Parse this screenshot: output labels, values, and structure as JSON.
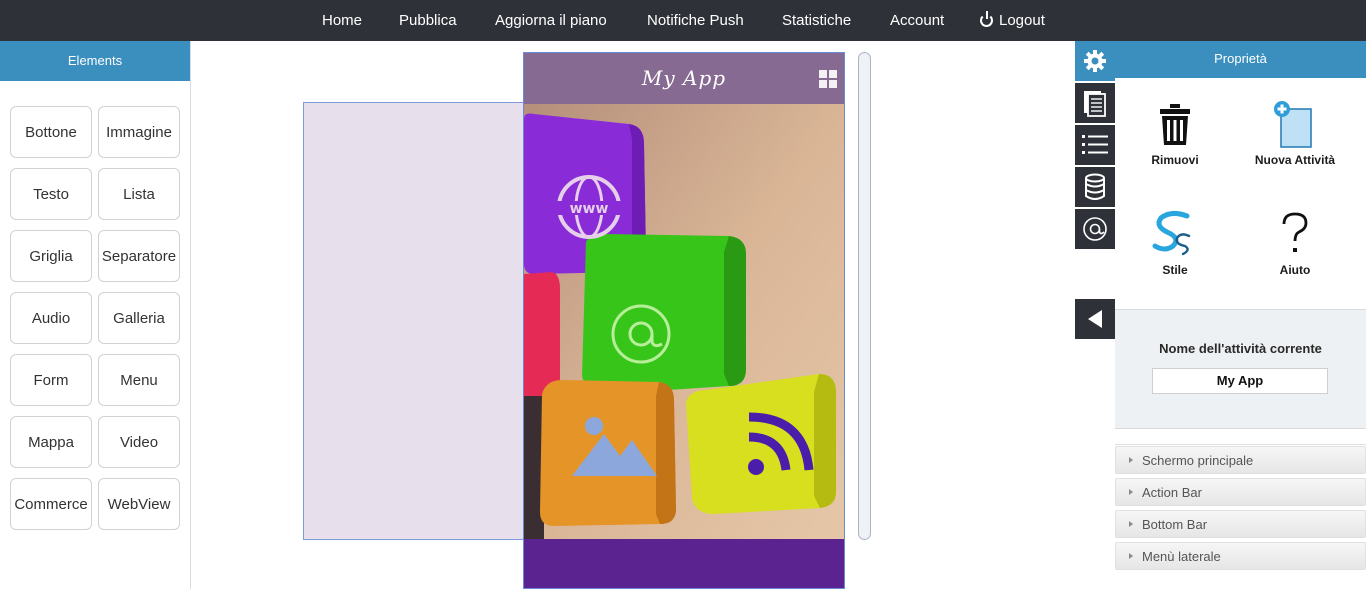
{
  "nav": {
    "items": [
      "Home",
      "Pubblica",
      "Aggiorna il piano",
      "Notifiche Push",
      "Statistiche",
      "Account"
    ],
    "logout_label": "Logout",
    "logout_icon": "power-icon"
  },
  "elements_panel": {
    "title": "Elements",
    "buttons": [
      "Bottone",
      "Immagine",
      "Testo",
      "Lista",
      "Griglia",
      "Separatore",
      "Audio",
      "Galleria",
      "Form",
      "Menu",
      "Mappa",
      "Video",
      "Commerce",
      "WebView"
    ]
  },
  "phone": {
    "title": "My App",
    "menu_icon": "grid-icon"
  },
  "side_tabs": [
    "gear-icon",
    "pages-icon",
    "list-icon",
    "database-icon",
    "at-icon"
  ],
  "properties": {
    "title": "Proprietà",
    "actions": [
      {
        "label": "Rimuovi",
        "icon": "trash-icon"
      },
      {
        "label": "Nuova Attività",
        "icon": "new-activity-icon"
      },
      {
        "label": "Stile",
        "icon": "style-icon"
      },
      {
        "label": "Aiuto",
        "icon": "question-icon"
      }
    ],
    "current_activity_label": "Nome dell'attività corrente",
    "current_activity_value": "My App"
  },
  "accordion": [
    "Schermo principale",
    "Action Bar",
    "Bottom Bar",
    "Menù laterale"
  ],
  "colors": {
    "topbar": "#2e3238",
    "accent": "#3a8fbf",
    "phone_bar": "#876a91",
    "phone_bottom": "#5a2390"
  }
}
